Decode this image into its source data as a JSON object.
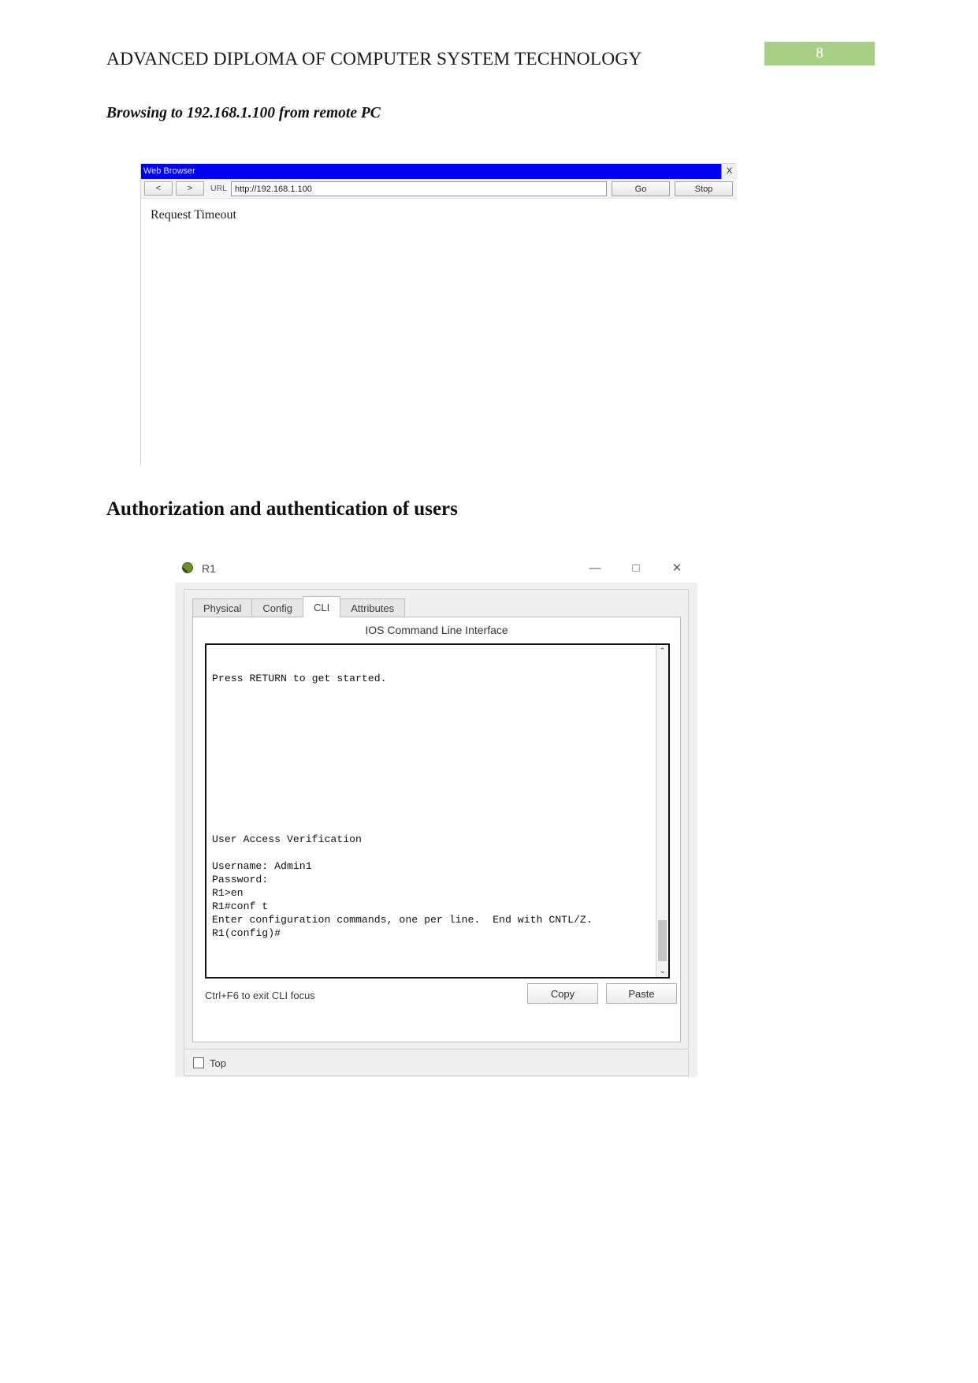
{
  "document": {
    "header_title": "ADVANCED DIPLOMA OF COMPUTER SYSTEM TECHNOLOGY",
    "page_number": "8",
    "page_badge_color": "#a8cf87",
    "subsection_title": "Browsing to 192.168.1.100 from remote PC",
    "section_title": "Authorization and authentication of users"
  },
  "browser": {
    "window_title": "Web Browser",
    "titlebar_color": "#0000f0",
    "close_label": "X",
    "back_label": "<",
    "forward_label": ">",
    "url_label": "URL",
    "url_value": "http://192.168.1.100",
    "url_placeholder": "http://",
    "go_label": "Go",
    "stop_label": "Stop",
    "page_content": "Request Timeout"
  },
  "packet_tracer": {
    "window_title": "R1",
    "device_icon": "router-icon",
    "window_controls": {
      "minimize": "—",
      "maximize": "□",
      "close": "✕"
    },
    "tabs": [
      {
        "label": "Physical",
        "active": false
      },
      {
        "label": "Config",
        "active": false
      },
      {
        "label": "CLI",
        "active": true
      },
      {
        "label": "Attributes",
        "active": false
      }
    ],
    "panel_title": "IOS Command Line Interface",
    "terminal_lines": [
      "",
      "",
      "Press RETURN to get started.",
      "",
      "",
      "",
      "",
      "",
      "",
      "",
      "",
      "",
      "",
      "",
      "User Access Verification",
      "",
      "Username: Admin1",
      "Password:",
      "R1>en",
      "R1#conf t",
      "Enter configuration commands, one per line.  End with CNTL/Z.",
      "R1(config)#"
    ],
    "scroll_up_glyph": "⌃",
    "scroll_down_glyph": "⌄",
    "focus_hint": "Ctrl+F6 to exit CLI focus",
    "copy_label": "Copy",
    "paste_label": "Paste",
    "top_checkbox_label": "Top",
    "top_checkbox_checked": false
  }
}
